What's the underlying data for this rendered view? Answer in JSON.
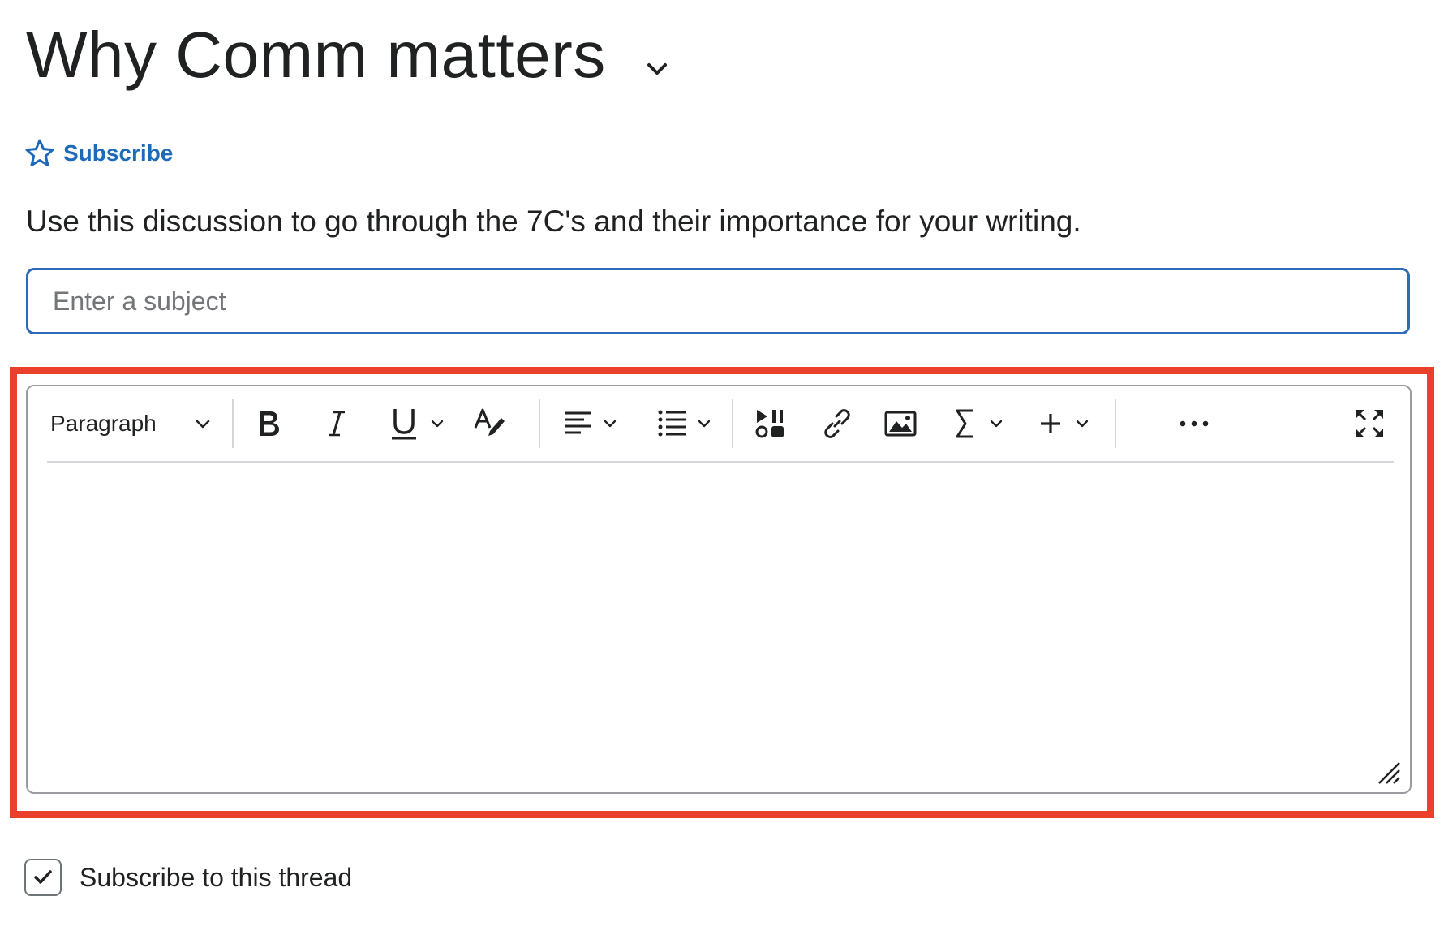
{
  "page": {
    "title": "Why Comm matters",
    "subscribe_label": "Subscribe",
    "description": "Use this discussion to go through the 7C's and their importance for your writing."
  },
  "subject": {
    "placeholder": "Enter a subject",
    "value": ""
  },
  "editor": {
    "block_format": "Paragraph",
    "toolbar_icons": [
      "bold-icon",
      "italic-icon",
      "underline-icon",
      "text-color-icon",
      "align-left-icon",
      "bullet-list-icon",
      "insert-stuff-icon",
      "link-icon",
      "image-icon",
      "equation-icon",
      "insert-plus-icon",
      "more-options-icon",
      "fullscreen-icon"
    ],
    "content": ""
  },
  "thread_subscription": {
    "label": "Subscribe to this thread",
    "checked": true
  },
  "colors": {
    "link": "#1e6ab8",
    "input_focus_border": "#2d6ab8",
    "highlight": "#e8402a",
    "text": "#202122"
  }
}
